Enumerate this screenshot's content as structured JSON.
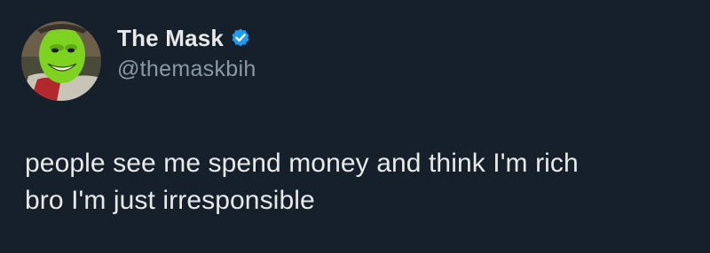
{
  "tweet": {
    "author": {
      "display_name": "The Mask",
      "handle": "@themaskbih",
      "verified": true,
      "avatar_icon": "mask-character-avatar"
    },
    "text_lines": [
      "people see me spend money and think I'm rich",
      "bro I'm just irresponsible"
    ]
  },
  "colors": {
    "background": "#15202b",
    "primary_text": "#e7e9ea",
    "secondary_text": "#8b98a5",
    "verified_badge": "#1d9bf0",
    "avatar_face": "#7ed321"
  }
}
